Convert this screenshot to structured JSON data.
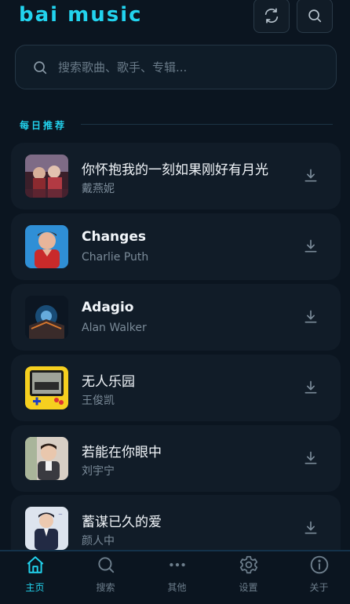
{
  "app": {
    "logo": "bai music"
  },
  "header": {
    "refresh_icon": "refresh-icon",
    "search_icon": "search-icon"
  },
  "search": {
    "placeholder": "搜索歌曲、歌手、专辑..."
  },
  "section": {
    "title": "每日推荐"
  },
  "songs": [
    {
      "title": "你怀抱我的一刻如果刚好有月光",
      "artist": "戴燕妮"
    },
    {
      "title": "Changes",
      "artist": "Charlie Puth"
    },
    {
      "title": "Adagio",
      "artist": "Alan Walker"
    },
    {
      "title": "无人乐园",
      "artist": "王俊凯"
    },
    {
      "title": "若能在你眼中",
      "artist": "刘宇宁"
    },
    {
      "title": "蓄谋已久的爱",
      "artist": "颜人中"
    }
  ],
  "nav": [
    {
      "label": "主页",
      "icon": "home-icon",
      "active": true
    },
    {
      "label": "搜索",
      "icon": "search-icon",
      "active": false
    },
    {
      "label": "其他",
      "icon": "more-icon",
      "active": false
    },
    {
      "label": "设置",
      "icon": "gear-icon",
      "active": false
    },
    {
      "label": "关于",
      "icon": "info-icon",
      "active": false
    }
  ],
  "colors": {
    "accent": "#22d3ee",
    "background": "#0b1520",
    "card": "#111c28",
    "muted": "#7b8b99"
  }
}
